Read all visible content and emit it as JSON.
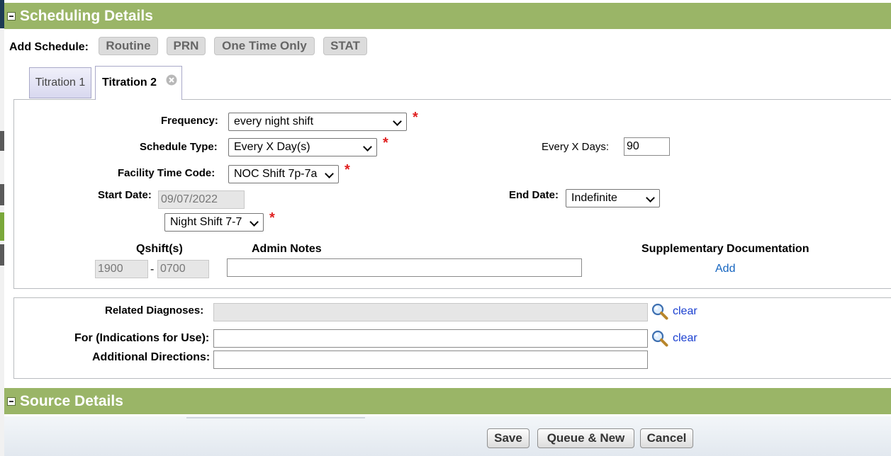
{
  "scheduling": {
    "title": "Scheduling Details"
  },
  "add_schedule": {
    "label": "Add Schedule:",
    "buttons": [
      "Routine",
      "PRN",
      "One Time Only",
      "STAT"
    ]
  },
  "tabs": [
    {
      "label": "Titration 1",
      "active": false
    },
    {
      "label": "Titration 2",
      "active": true
    }
  ],
  "form": {
    "frequency_label": "Frequency:",
    "frequency_value": "every night shift",
    "schedule_type_label": "Schedule Type:",
    "schedule_type_value": "Every X Day(s)",
    "every_x_days_label": "Every X Days:",
    "every_x_days_value": "90",
    "facility_time_code_label": "Facility Time Code:",
    "facility_time_code_value": "NOC Shift 7p-7a",
    "start_date_label": "Start Date:",
    "start_date_value": "09/07/2022",
    "end_date_label": "End Date:",
    "end_date_value": "Indefinite",
    "shift_value": "Night Shift 7-7",
    "qshift_label": "Qshift(s)",
    "qshift_start": "1900",
    "qshift_separator": "-",
    "qshift_end": "0700",
    "admin_notes_label": "Admin Notes",
    "admin_notes_value": "",
    "supplementary_label": "Supplementary Documentation",
    "supplementary_add": "Add",
    "required_mark": "*"
  },
  "diagnoses": {
    "related_label": "Related Diagnoses:",
    "related_value": "",
    "indications_label": "For (Indications for Use):",
    "indications_value": "",
    "directions_label": "Additional Directions:",
    "directions_value": "",
    "clear_label": "clear"
  },
  "source": {
    "title": "Source Details"
  },
  "footer": {
    "save": "Save",
    "queue_new": "Queue & New",
    "cancel": "Cancel"
  },
  "colors": {
    "header_green": "#9ab567",
    "required_red": "#e02020",
    "link_blue": "#1565c0"
  }
}
